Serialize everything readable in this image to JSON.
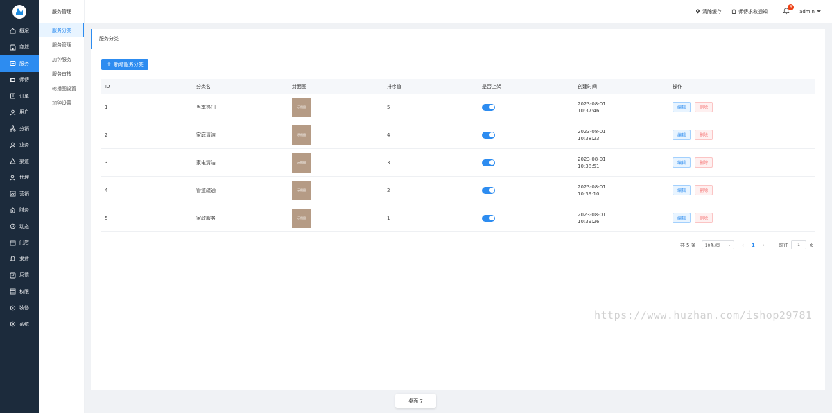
{
  "colors": {
    "sidebar_bg": "#1c2b3c",
    "accent": "#2d8cf0",
    "danger": "#f56c6c",
    "cover": "#b59b85"
  },
  "sidebar": {
    "items": [
      {
        "label": "概况",
        "icon": "home-icon"
      },
      {
        "label": "商城",
        "icon": "shop-icon"
      },
      {
        "label": "服务",
        "icon": "service-icon",
        "active": true
      },
      {
        "label": "师傅",
        "icon": "worker-icon"
      },
      {
        "label": "订单",
        "icon": "order-icon"
      },
      {
        "label": "用户",
        "icon": "user-icon"
      },
      {
        "label": "分销",
        "icon": "distribution-icon"
      },
      {
        "label": "业务",
        "icon": "business-icon"
      },
      {
        "label": "渠道",
        "icon": "channel-icon"
      },
      {
        "label": "代理",
        "icon": "agent-icon"
      },
      {
        "label": "营销",
        "icon": "marketing-icon"
      },
      {
        "label": "财务",
        "icon": "finance-icon"
      },
      {
        "label": "动态",
        "icon": "dynamic-icon"
      },
      {
        "label": "门店",
        "icon": "store-icon"
      },
      {
        "label": "求救",
        "icon": "sos-icon"
      },
      {
        "label": "反馈",
        "icon": "feedback-icon"
      },
      {
        "label": "权限",
        "icon": "permission-icon"
      },
      {
        "label": "装修",
        "icon": "decoration-icon"
      },
      {
        "label": "系统",
        "icon": "system-icon"
      }
    ]
  },
  "submenu": {
    "title": "服务管理",
    "items": [
      {
        "label": "服务分类",
        "active": true
      },
      {
        "label": "服务管理"
      },
      {
        "label": "加钟服务"
      },
      {
        "label": "服务审核"
      },
      {
        "label": "轮播图设置"
      },
      {
        "label": "加钟设置"
      }
    ]
  },
  "header": {
    "clear_cache": "清除缓存",
    "sos_notice": "师傅求救通知",
    "bell_badge": "4",
    "user": "admin"
  },
  "card": {
    "title": "服务分类",
    "add_button": "新增服务分类"
  },
  "table": {
    "headers": [
      "ID",
      "分类名",
      "封面图",
      "排序值",
      "是否上架",
      "创建时间",
      "操作"
    ],
    "cover_text": "示例图",
    "edit_label": "编辑",
    "delete_label": "删除",
    "rows": [
      {
        "id": "1",
        "name": "当季热门",
        "sort": "5",
        "on_shelf": true,
        "date": "2023-08-01",
        "time": "10:37:46"
      },
      {
        "id": "2",
        "name": "家庭清洁",
        "sort": "4",
        "on_shelf": true,
        "date": "2023-08-01",
        "time": "10:38:23"
      },
      {
        "id": "3",
        "name": "家电清洁",
        "sort": "3",
        "on_shelf": true,
        "date": "2023-08-01",
        "time": "10:38:51"
      },
      {
        "id": "4",
        "name": "管道疏通",
        "sort": "2",
        "on_shelf": true,
        "date": "2023-08-01",
        "time": "10:39:10"
      },
      {
        "id": "5",
        "name": "家政服务",
        "sort": "1",
        "on_shelf": true,
        "date": "2023-08-01",
        "time": "10:39:26"
      }
    ]
  },
  "pagination": {
    "total": "共 5 条",
    "page_size": "10条/页",
    "prev": "‹",
    "current": "1",
    "next": "›",
    "goto": "前往",
    "goto_value": "1",
    "page_unit": "页"
  },
  "watermark": "https://www.huzhan.com/ishop29781",
  "footer": {
    "tab": "桌面 7"
  }
}
